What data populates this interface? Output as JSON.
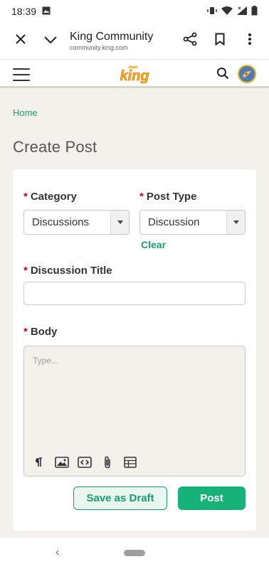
{
  "status_bar": {
    "time": "18:39",
    "icons": [
      "gallery-icon",
      "vibrate-icon",
      "wifi-icon",
      "signal-icon",
      "battery-icon"
    ]
  },
  "browser": {
    "page_title": "King Community",
    "url": "community.king.com",
    "icons": [
      "close-icon",
      "chevron-down-icon",
      "share-icon",
      "bookmark-icon",
      "more-vert-icon"
    ]
  },
  "site_header": {
    "logo_text": "king",
    "icons": [
      "menu-icon",
      "search-icon",
      "avatar"
    ],
    "brand_color": "#f5a623"
  },
  "breadcrumb": {
    "home": "Home"
  },
  "page": {
    "title": "Create Post"
  },
  "form": {
    "required_mark": "*",
    "category": {
      "label": "Category",
      "selected": "Discussions"
    },
    "post_type": {
      "label": "Post Type",
      "selected": "Discussion",
      "clear_label": "Clear"
    },
    "discussion_title": {
      "label": "Discussion Title",
      "value": ""
    },
    "body": {
      "label": "Body",
      "placeholder": "Type...",
      "toolbar": [
        "paragraph-icon",
        "image-icon",
        "code-icon",
        "attachment-icon",
        "table-icon"
      ]
    },
    "actions": {
      "save_draft": "Save as Draft",
      "post": "Post"
    }
  },
  "colors": {
    "accent_green": "#16a06b",
    "post_button": "#16b27a",
    "required_red": "#d0021b",
    "page_bg": "#f4f1ec"
  },
  "nav_bar": {
    "back_glyph": "‹"
  }
}
